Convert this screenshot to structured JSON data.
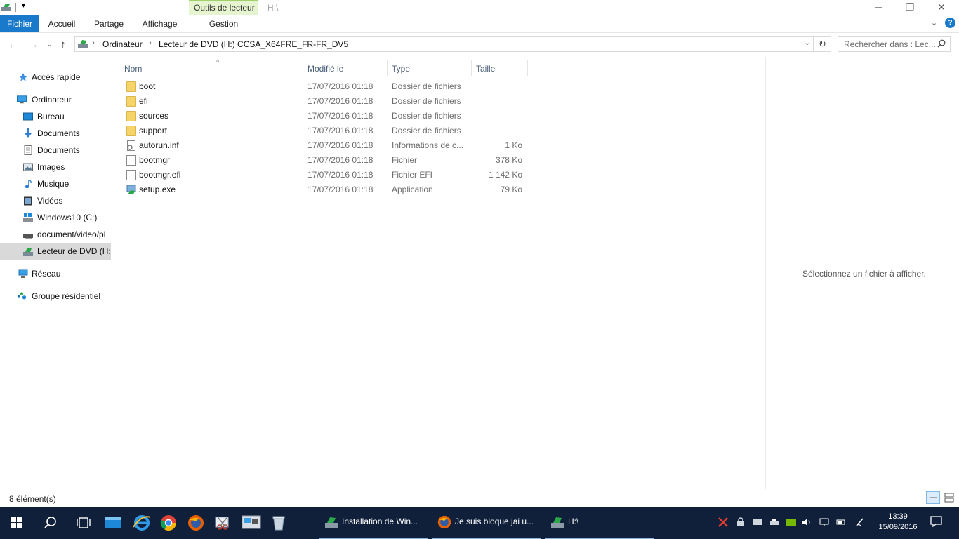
{
  "titlebar": {
    "context_group": "Outils de lecteur",
    "title": "H:\\",
    "minimize": "─",
    "maximize": "❐",
    "close": "✕"
  },
  "ribbon": {
    "tabs": [
      "Fichier",
      "Accueil",
      "Partage",
      "Affichage"
    ],
    "context_tab": "Gestion"
  },
  "address": {
    "crumbs": [
      "Ordinateur",
      "Lecteur de DVD (H:) CCSA_X64FRE_FR-FR_DV5"
    ]
  },
  "search": {
    "placeholder": "Rechercher dans : Lec..."
  },
  "nav": {
    "items": [
      {
        "label": "Accès rapide",
        "icon": "star-icon"
      },
      {
        "label": "Ordinateur",
        "icon": "computer-icon"
      },
      {
        "label": "Bureau",
        "icon": "desktop-icon"
      },
      {
        "label": "Documents",
        "icon": "download-icon"
      },
      {
        "label": "Documents",
        "icon": "documents-icon"
      },
      {
        "label": "Images",
        "icon": "images-icon"
      },
      {
        "label": "Musique",
        "icon": "music-icon"
      },
      {
        "label": "Vidéos",
        "icon": "videos-icon"
      },
      {
        "label": "Windows10 (C:)",
        "icon": "drive-icon"
      },
      {
        "label": "document/video/pl",
        "icon": "network-drive-icon"
      },
      {
        "label": "Lecteur de DVD (H:)",
        "icon": "dvd-drive-icon"
      },
      {
        "label": "Réseau",
        "icon": "network-icon"
      },
      {
        "label": "Groupe résidentiel",
        "icon": "homegroup-icon"
      }
    ]
  },
  "columns": [
    "Nom",
    "Modifié le",
    "Type",
    "Taille"
  ],
  "files": [
    {
      "name": "boot",
      "date": "17/07/2016 01:18",
      "type": "Dossier de fichiers",
      "size": "",
      "kind": "folder"
    },
    {
      "name": "efi",
      "date": "17/07/2016 01:18",
      "type": "Dossier de fichiers",
      "size": "",
      "kind": "folder"
    },
    {
      "name": "sources",
      "date": "17/07/2016 01:18",
      "type": "Dossier de fichiers",
      "size": "",
      "kind": "folder"
    },
    {
      "name": "support",
      "date": "17/07/2016 01:18",
      "type": "Dossier de fichiers",
      "size": "",
      "kind": "folder"
    },
    {
      "name": "autorun.inf",
      "date": "17/07/2016 01:18",
      "type": "Informations de c...",
      "size": "1 Ko",
      "kind": "inf"
    },
    {
      "name": "bootmgr",
      "date": "17/07/2016 01:18",
      "type": "Fichier",
      "size": "378 Ko",
      "kind": "file"
    },
    {
      "name": "bootmgr.efi",
      "date": "17/07/2016 01:18",
      "type": "Fichier EFI",
      "size": "1 142 Ko",
      "kind": "file"
    },
    {
      "name": "setup.exe",
      "date": "17/07/2016 01:18",
      "type": "Application",
      "size": "79 Ko",
      "kind": "exe"
    }
  ],
  "preview": {
    "message": "Sélectionnez un fichier à afficher."
  },
  "status": {
    "count": "8 élément(s)"
  },
  "taskbar": {
    "tasks": [
      {
        "label": "Installation de Win..."
      },
      {
        "label": "Je suis bloque jai u..."
      },
      {
        "label": "H:\\"
      }
    ],
    "time": "13:39",
    "date": "15/09/2016"
  },
  "colors": {
    "accent": "#1979ca",
    "taskbar": "#10203a",
    "context_tab": "#e6f5cf",
    "selection": "#d9d9d9",
    "folder": "#f7d46a"
  }
}
